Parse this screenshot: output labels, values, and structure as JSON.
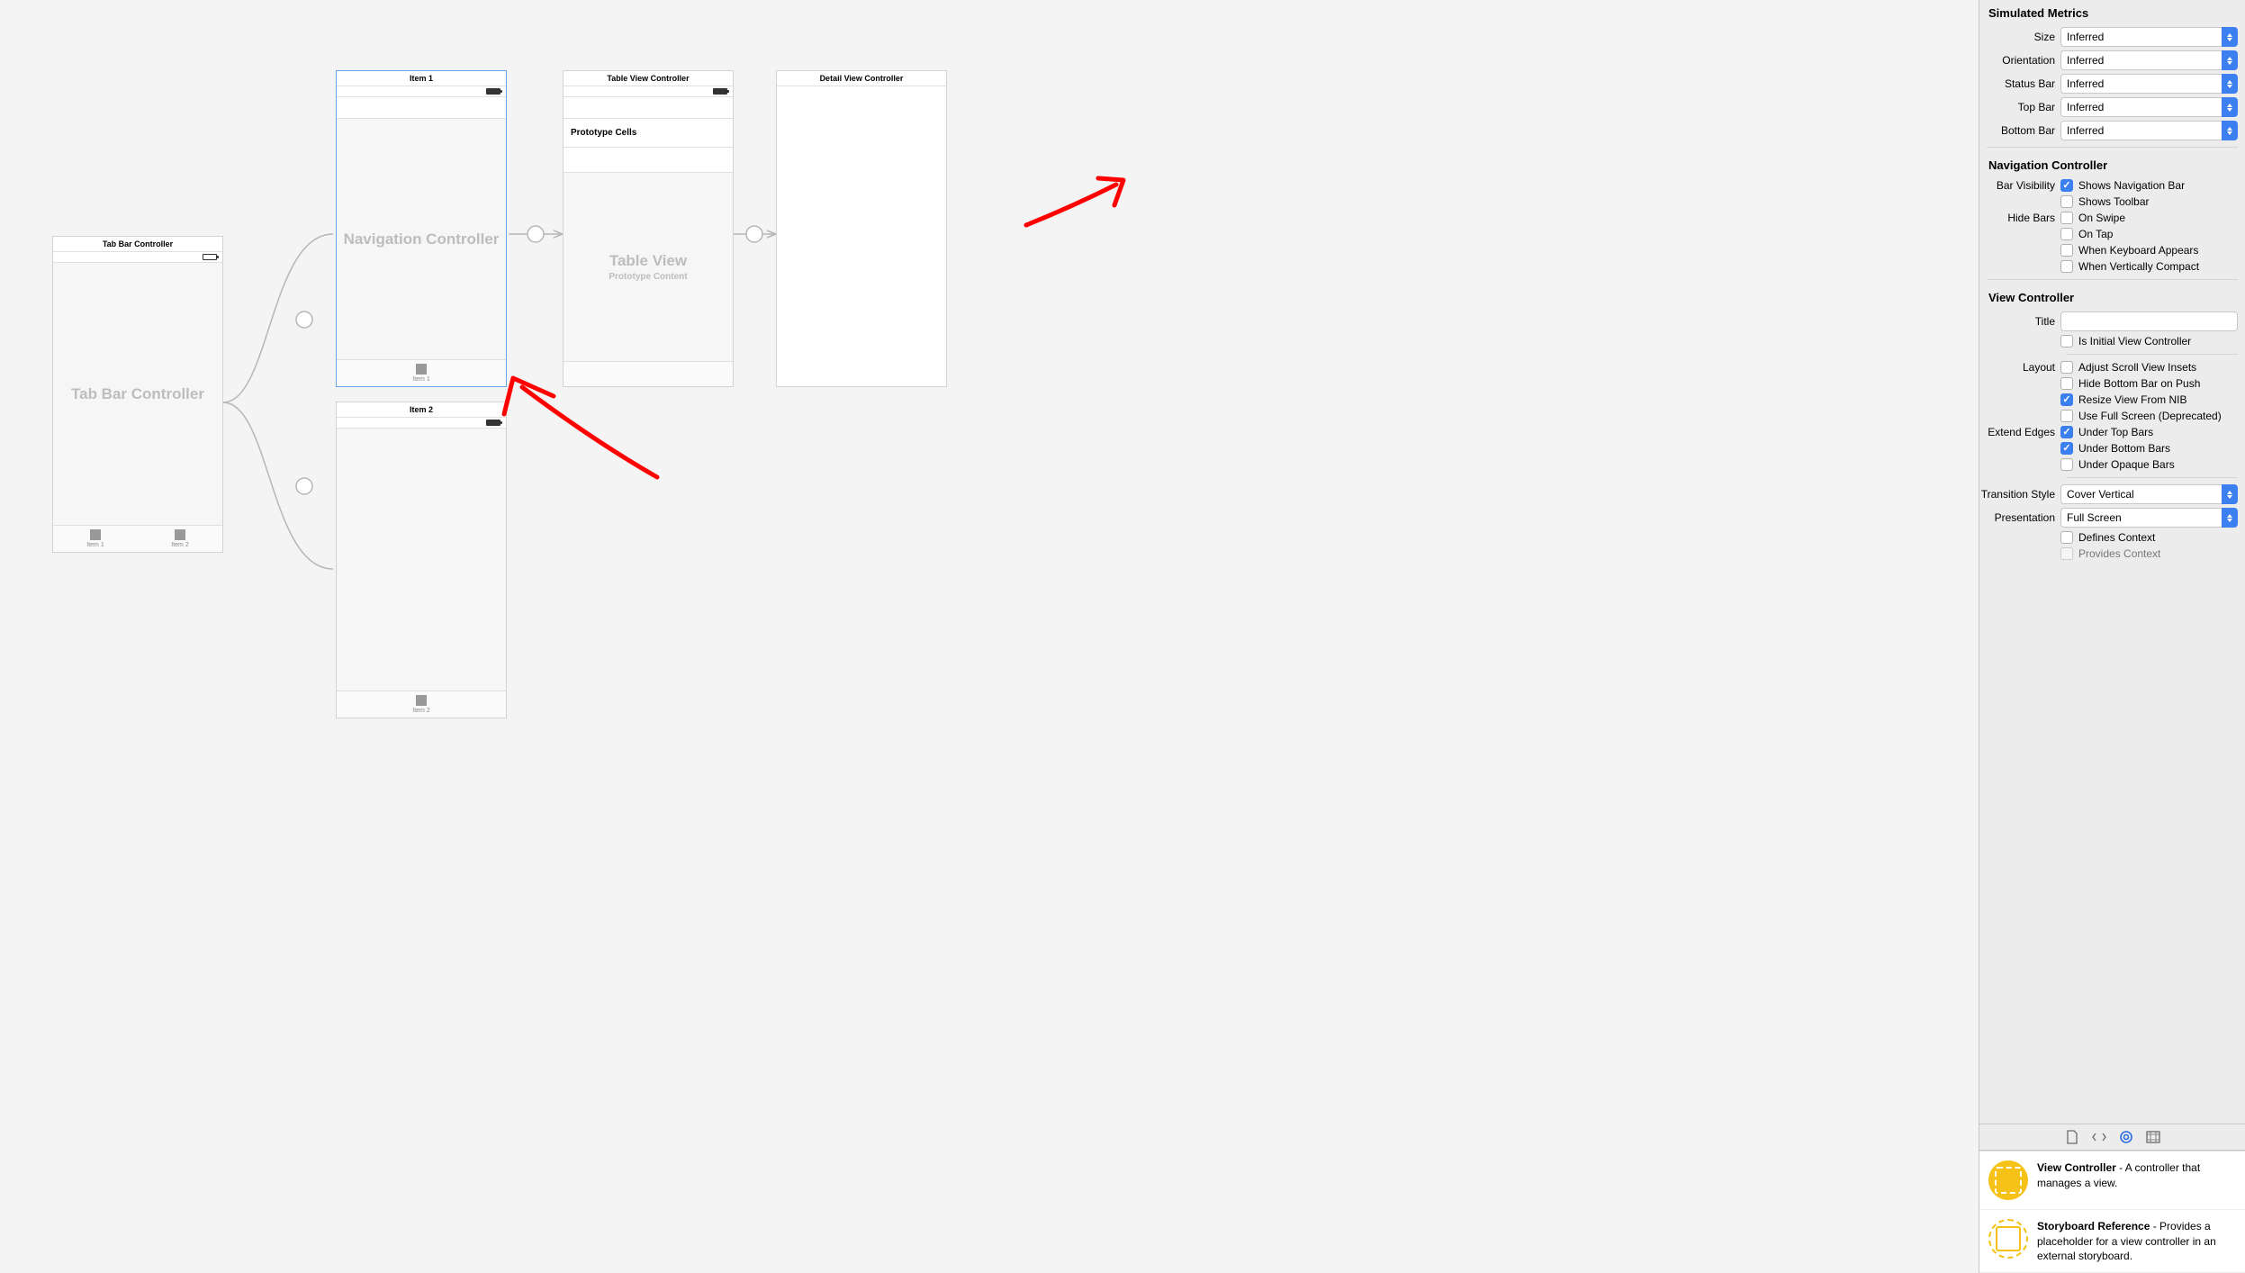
{
  "canvas": {
    "tab_bar_controller": {
      "title": "Tab Bar Controller",
      "body_label": "Tab Bar Controller",
      "tab1": "Item 1",
      "tab2": "Item 2"
    },
    "nav1": {
      "title": "Item 1",
      "body_label": "Navigation Controller",
      "tab": "Item 1"
    },
    "nav2": {
      "title": "Item 2",
      "tab": "Item 2"
    },
    "table_vc": {
      "title": "Table View Controller",
      "proto": "Prototype Cells",
      "body_label": "Table View",
      "body_sub": "Prototype Content"
    },
    "detail_vc": {
      "title": "Detail View Controller"
    }
  },
  "inspector": {
    "simulated_metrics": {
      "header": "Simulated Metrics",
      "size_label": "Size",
      "size_value": "Inferred",
      "orientation_label": "Orientation",
      "orientation_value": "Inferred",
      "status_label": "Status Bar",
      "status_value": "Inferred",
      "top_label": "Top Bar",
      "top_value": "Inferred",
      "bottom_label": "Bottom Bar",
      "bottom_value": "Inferred"
    },
    "nav_controller": {
      "header": "Navigation Controller",
      "bar_visibility_label": "Bar Visibility",
      "shows_nav": "Shows Navigation Bar",
      "shows_toolbar": "Shows Toolbar",
      "hide_bars_label": "Hide Bars",
      "on_swipe": "On Swipe",
      "on_tap": "On Tap",
      "keyboard": "When Keyboard Appears",
      "compact": "When Vertically Compact"
    },
    "view_controller": {
      "header": "View Controller",
      "title_label": "Title",
      "title_value": "",
      "initial": "Is Initial View Controller",
      "layout_label": "Layout",
      "adjust_scroll": "Adjust Scroll View Insets",
      "hide_bottom": "Hide Bottom Bar on Push",
      "resize_nib": "Resize View From NIB",
      "full_screen_dep": "Use Full Screen (Deprecated)",
      "extend_label": "Extend Edges",
      "under_top": "Under Top Bars",
      "under_bottom": "Under Bottom Bars",
      "under_opaque": "Under Opaque Bars",
      "transition_label": "Transition Style",
      "transition_value": "Cover Vertical",
      "presentation_label": "Presentation",
      "presentation_value": "Full Screen",
      "defines_context": "Defines Context",
      "provides_context": "Provides Context"
    },
    "library": {
      "vc_title": "View Controller",
      "vc_desc": " - A controller that manages a view.",
      "sr_title": "Storyboard Reference",
      "sr_desc": " - Provides a placeholder for a view controller in an external storyboard."
    }
  }
}
